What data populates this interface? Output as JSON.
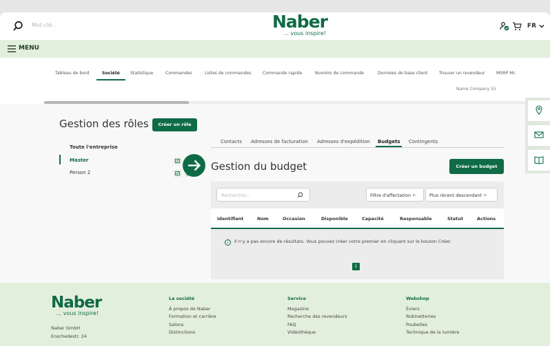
{
  "header": {
    "search_placeholder": "Mot-clé...",
    "logo": "Naber",
    "tagline": "... vous inspire!",
    "language": "FR",
    "icons": [
      "user-check-icon",
      "cart-icon",
      "chevron-down-icon"
    ]
  },
  "menu": {
    "label": "MENU"
  },
  "nav": {
    "tabs": [
      {
        "label": "Tableau de bord",
        "active": false
      },
      {
        "label": "Société",
        "active": true
      },
      {
        "label": "Statistique",
        "active": false
      },
      {
        "label": "Commandes",
        "active": false
      },
      {
        "label": "Listes de commandes",
        "active": false
      },
      {
        "label": "Commande rapide",
        "active": false
      },
      {
        "label": "Numéro de commande",
        "active": false
      },
      {
        "label": "Données de base client",
        "active": false
      },
      {
        "label": "Trouver un revendeur",
        "active": false
      },
      {
        "label": "MSRP Mc",
        "active": false
      }
    ],
    "company": "Name Company 55"
  },
  "roles": {
    "title": "Gestion des rôles",
    "create_label": "Créer un rôle",
    "group": "Toute l'entreprise",
    "items": [
      {
        "label": "Master",
        "active": true
      },
      {
        "label": "Person 2",
        "active": false
      }
    ]
  },
  "budget": {
    "tabs": [
      {
        "label": "Contacts",
        "active": false
      },
      {
        "label": "Adresses de facturation",
        "active": false
      },
      {
        "label": "Adresses d'expédition",
        "active": false
      },
      {
        "label": "Budgets",
        "active": true
      },
      {
        "label": "Contingents",
        "active": false
      }
    ],
    "title": "Gestion du budget",
    "create_label": "Créer un budget",
    "search_placeholder": "Rechercher...",
    "filter_label": "Filtre d'affectation ÷",
    "sort_label": "Plus récent descendant ÷",
    "columns": [
      "Identifiant",
      "Nom",
      "Occasion",
      "Disponible",
      "Capacité",
      "Responsable",
      "Statut",
      "Actions"
    ],
    "empty_message": "Il n'y a pas encore de résultats. Vous pouvez créer votre premier en cliquant sur le bouton Créer.",
    "page": "1"
  },
  "side_actions": [
    "location-pin-icon",
    "envelope-icon",
    "catalog-book-icon"
  ],
  "footer": {
    "logo": "Naber",
    "tagline": "... vous inspire!",
    "address": [
      "Naber GmbH",
      "Enschedestr. 24"
    ],
    "columns": [
      {
        "title": "La société",
        "links": [
          "À propos de Naber",
          "Formation et carrière",
          "Salons",
          "Distinctions"
        ]
      },
      {
        "title": "Service",
        "links": [
          "Magazine",
          "Recherche des revendeurs",
          "FAQ",
          "Vidéothèque"
        ]
      },
      {
        "title": "Webshop",
        "links": [
          "Éviers",
          "Robinetteries",
          "Poubelles",
          "Technique de la lumière"
        ]
      }
    ]
  },
  "colors": {
    "brand": "#0f6b46",
    "menubar": "#e3efdd",
    "footer": "#e3efdd"
  }
}
